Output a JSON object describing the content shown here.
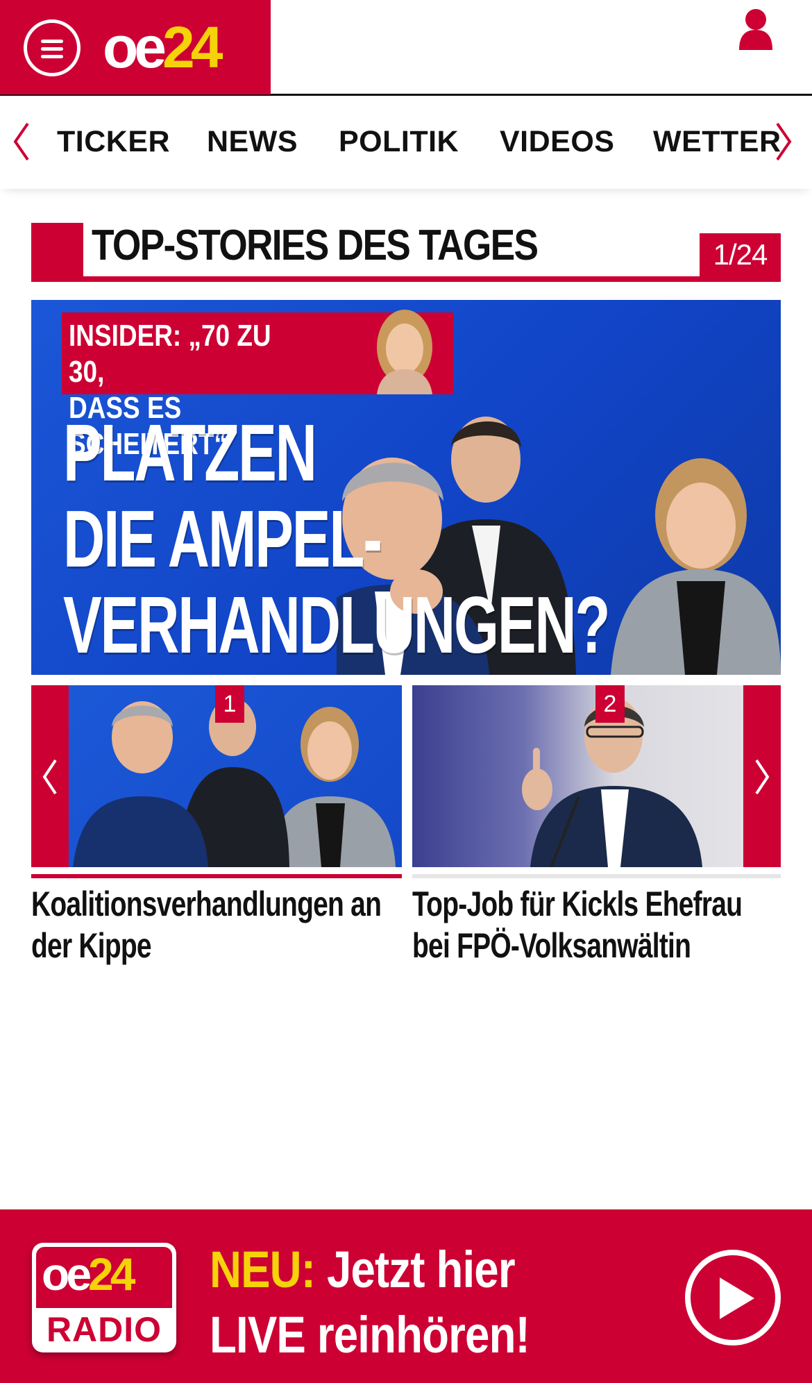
{
  "header": {
    "logo_oe": "oe",
    "logo_num": "24",
    "brand_color": "#cc0033",
    "accent_color": "#f5d20a"
  },
  "nav": {
    "items": [
      "TICKER",
      "NEWS",
      "POLITIK",
      "VIDEOS",
      "WETTER"
    ]
  },
  "section": {
    "title": "TOP-STORIES DES TAGES",
    "counter": "1/24"
  },
  "hero": {
    "tag": "INSIDER: „70 ZU 30,\nDASS ES SCHEITERT“",
    "headline": "PLATZEN\nDIE AMPEL-\nVERHANDLUNGEN?"
  },
  "cards": [
    {
      "badge": "1",
      "title": "Koalitionsverhandlungen an der Kippe"
    },
    {
      "badge": "2",
      "title": "Top-Job für Kickls Ehefrau bei FPÖ-Volksanwältin"
    }
  ],
  "radio": {
    "logo_oe": "oe",
    "logo_num": "24",
    "logo_label": "RADIO",
    "neu": "NEU:",
    "line1_rest": " Jetzt hier",
    "line2": "LIVE reinhören!"
  }
}
